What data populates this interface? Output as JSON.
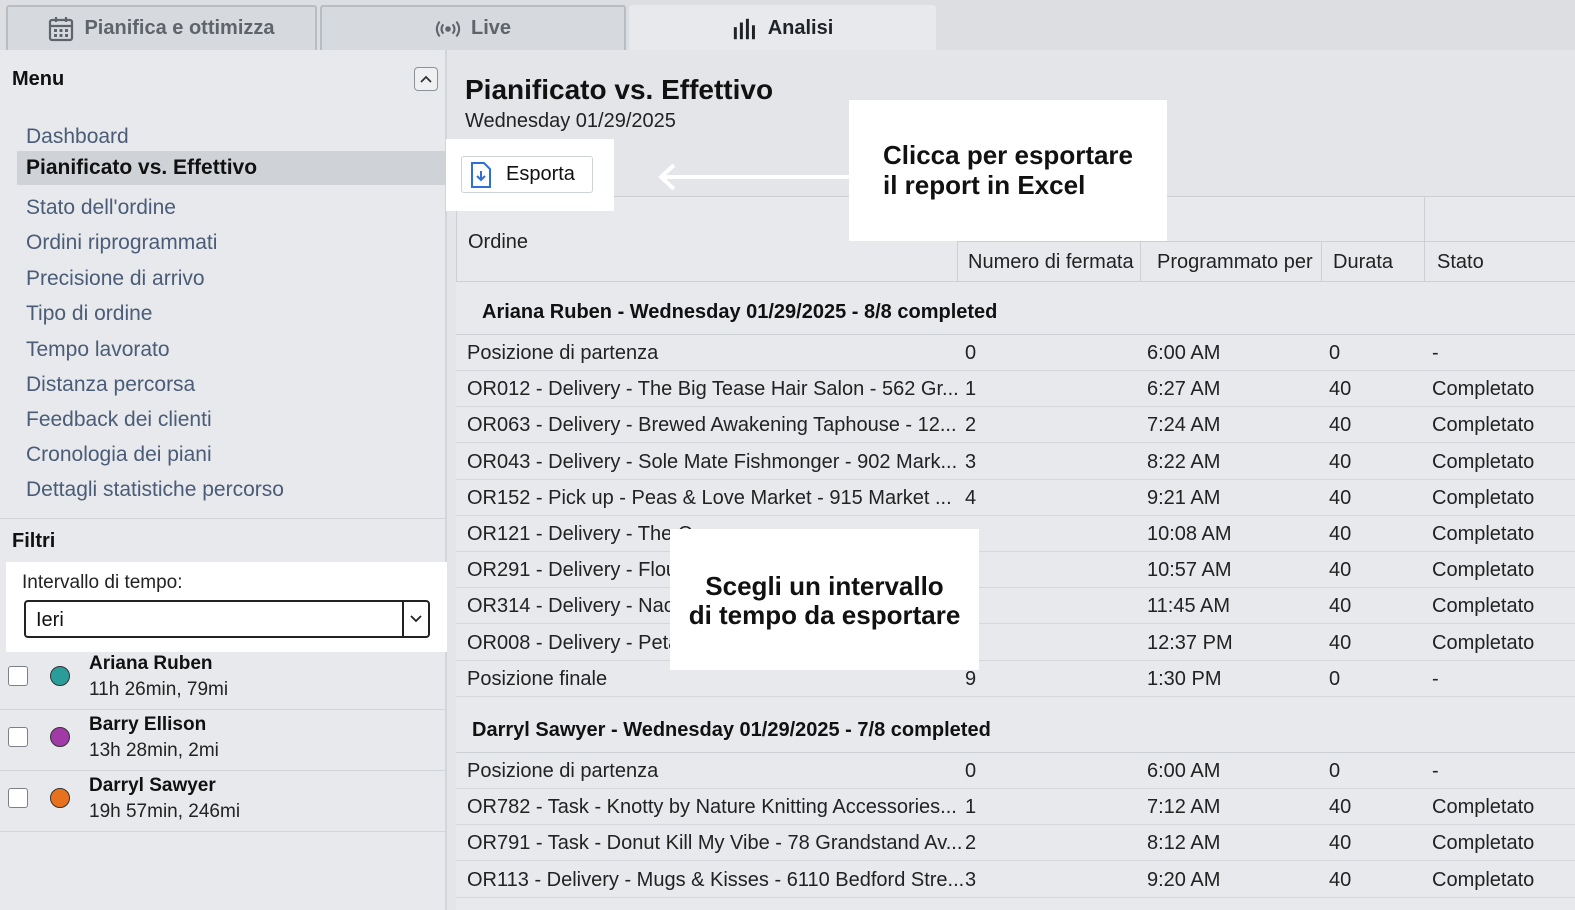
{
  "tabs": [
    {
      "label": "Pianifica e ottimizza",
      "icon": "calendar-icon",
      "active": false
    },
    {
      "label": "Live",
      "icon": "broadcast-icon",
      "active": false
    },
    {
      "label": "Analisi",
      "icon": "bar-chart-icon",
      "active": true
    }
  ],
  "sidebar": {
    "menu_title": "Menu",
    "items": [
      {
        "label": "Dashboard"
      },
      {
        "label": "Pianificato vs. Effettivo",
        "active": true
      },
      {
        "label": "Stato dell'ordine"
      },
      {
        "label": "Ordini riprogrammati"
      },
      {
        "label": "Precisione di arrivo"
      },
      {
        "label": "Tipo di ordine"
      },
      {
        "label": "Tempo lavorato"
      },
      {
        "label": "Distanza percorsa"
      },
      {
        "label": "Feedback dei clienti"
      },
      {
        "label": "Cronologia dei piani"
      },
      {
        "label": "Dettagli statistiche percorso"
      }
    ],
    "filters_title": "Filtri",
    "interval_label": "Intervallo di tempo:",
    "interval_value": "Ieri",
    "drivers": [
      {
        "name": "Ariana Ruben",
        "stats": "11h 26min, 79mi",
        "color": "#2a9d9a"
      },
      {
        "name": "Barry Ellison",
        "stats": "13h 28min, 2mi",
        "color": "#a03aa6"
      },
      {
        "name": "Darryl Sawyer",
        "stats": "19h 57min, 246mi",
        "color": "#e8711d"
      }
    ]
  },
  "main": {
    "title": "Pianificato vs. Effettivo",
    "date": "Wednesday 01/29/2025",
    "export_label": "Esporta",
    "callout_export_line1": "Clicca per esportare",
    "callout_export_line2": "il report in Excel",
    "callout_interval_line1": "Scegli un intervallo",
    "callout_interval_line2": "di tempo da esportare",
    "columns": {
      "order": "Ordine",
      "stop": "Numero di fermata",
      "scheduled": "Programmato per",
      "duration": "Durata",
      "status": "Stato"
    },
    "groups": [
      {
        "title": "Ariana Ruben - Wednesday 01/29/2025 - 8/8 completed",
        "rows": [
          {
            "order": "Posizione di partenza",
            "stop": "0",
            "time": "6:00 AM",
            "duration": "0",
            "status": "-"
          },
          {
            "order": "OR012 - Delivery - The Big Tease Hair Salon - 562 Gr...",
            "stop": "1",
            "time": "6:27 AM",
            "duration": "40",
            "status": "Completato"
          },
          {
            "order": "OR063 - Delivery - Brewed Awakening Taphouse - 12...",
            "stop": "2",
            "time": "7:24 AM",
            "duration": "40",
            "status": "Completato"
          },
          {
            "order": "OR043 - Delivery - Sole Mate Fishmonger - 902 Mark...",
            "stop": "3",
            "time": "8:22 AM",
            "duration": "40",
            "status": "Completato"
          },
          {
            "order": "OR152 - Pick up - Peas & Love Market - 915 Market ...",
            "stop": "4",
            "time": "9:21 AM",
            "duration": "40",
            "status": "Completato"
          },
          {
            "order": "OR121 - Delivery - The C",
            "stop": "",
            "time": "10:08 AM",
            "duration": "40",
            "status": "Completato"
          },
          {
            "order": "OR291 - Delivery - Flour",
            "stop": "",
            "time": "10:57 AM",
            "duration": "40",
            "status": "Completato"
          },
          {
            "order": "OR314 - Delivery - Nach",
            "stop": "",
            "time": "11:45 AM",
            "duration": "40",
            "status": "Completato"
          },
          {
            "order": "OR008 - Delivery - Petal",
            "stop": "",
            "time": "12:37 PM",
            "duration": "40",
            "status": "Completato"
          },
          {
            "order": "Posizione finale",
            "stop": "9",
            "time": "1:30 PM",
            "duration": "0",
            "status": "-"
          }
        ]
      },
      {
        "title": "Darryl Sawyer - Wednesday 01/29/2025 - 7/8 completed",
        "rows": [
          {
            "order": "Posizione di partenza",
            "stop": "0",
            "time": "6:00 AM",
            "duration": "0",
            "status": "-"
          },
          {
            "order": "OR782 - Task - Knotty by Nature Knitting Accessories...",
            "stop": "1",
            "time": "7:12 AM",
            "duration": "40",
            "status": "Completato"
          },
          {
            "order": "OR791 - Task - Donut Kill My Vibe - 78 Grandstand Av...",
            "stop": "2",
            "time": "8:12 AM",
            "duration": "40",
            "status": "Completato"
          },
          {
            "order": "OR113 - Delivery - Mugs & Kisses - 6110 Bedford Stre...",
            "stop": "3",
            "time": "9:20 AM",
            "duration": "40",
            "status": "Completato"
          }
        ]
      }
    ]
  }
}
